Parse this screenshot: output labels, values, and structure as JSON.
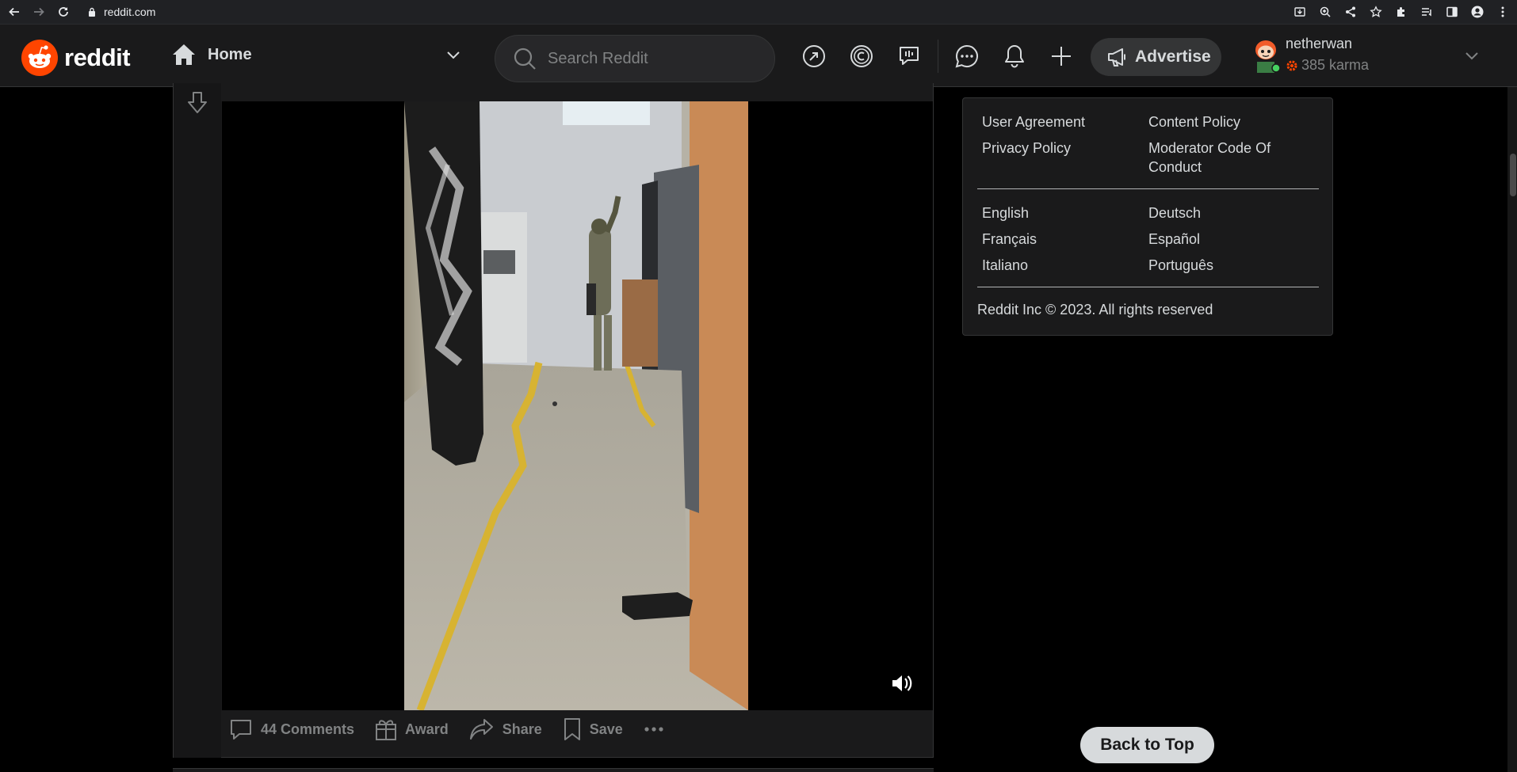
{
  "browser": {
    "url": "reddit.com"
  },
  "header": {
    "logo_text": "reddit",
    "feed_label": "Home",
    "search_placeholder": "Search Reddit",
    "advertise_label": "Advertise",
    "username": "netherwan",
    "karma": "385 karma",
    "icons": [
      "popular-icon",
      "coins-icon",
      "chat-bubble-poll-icon",
      "chat-icon",
      "notification-bell-icon",
      "create-post-plus-icon"
    ]
  },
  "post": {
    "actions": {
      "comments": "44 Comments",
      "award": "Award",
      "share": "Share",
      "save": "Save"
    }
  },
  "footer": {
    "links": [
      [
        "User Agreement",
        "Content Policy"
      ],
      [
        "Privacy Policy",
        "Moderator Code Of Conduct"
      ]
    ],
    "languages": [
      [
        "English",
        "Deutsch"
      ],
      [
        "Français",
        "Español"
      ],
      [
        "Italiano",
        "Português"
      ]
    ],
    "copyright": "Reddit Inc © 2023. All rights reserved"
  },
  "back_to_top": "Back to Top",
  "colors": {
    "brand": "#ff4500",
    "background": "#000000",
    "surface": "#1a1a1b",
    "text": "#d7dadc",
    "muted": "#818384",
    "online": "#46d160"
  }
}
